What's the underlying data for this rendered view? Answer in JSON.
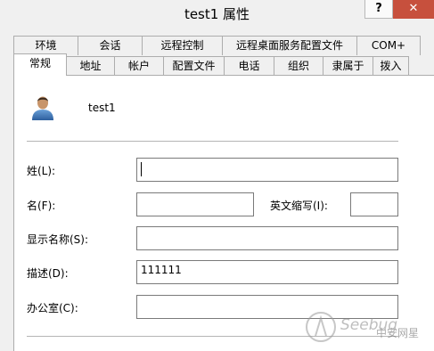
{
  "window": {
    "title": "test1 属性",
    "help_label": "?",
    "close_label": "✕"
  },
  "tabs": {
    "row1": [
      "环境",
      "会话",
      "远程控制",
      "远程桌面服务配置文件",
      "COM+"
    ],
    "row2": [
      "常规",
      "地址",
      "帐户",
      "配置文件",
      "电话",
      "组织",
      "隶属于",
      "拨入"
    ],
    "active": "常规"
  },
  "general": {
    "username": "test1",
    "fields": {
      "last_name": {
        "label": "姓(L):",
        "value": ""
      },
      "first_name": {
        "label": "名(F):",
        "value": ""
      },
      "initials": {
        "label": "英文缩写(I):",
        "value": ""
      },
      "display_name": {
        "label": "显示名称(S):",
        "value": ""
      },
      "description": {
        "label": "描述(D):",
        "value": "111111"
      },
      "office": {
        "label": "办公室(C):",
        "value": ""
      }
    }
  },
  "watermark": {
    "brand": "Seebug",
    "cn": "中安网星"
  }
}
